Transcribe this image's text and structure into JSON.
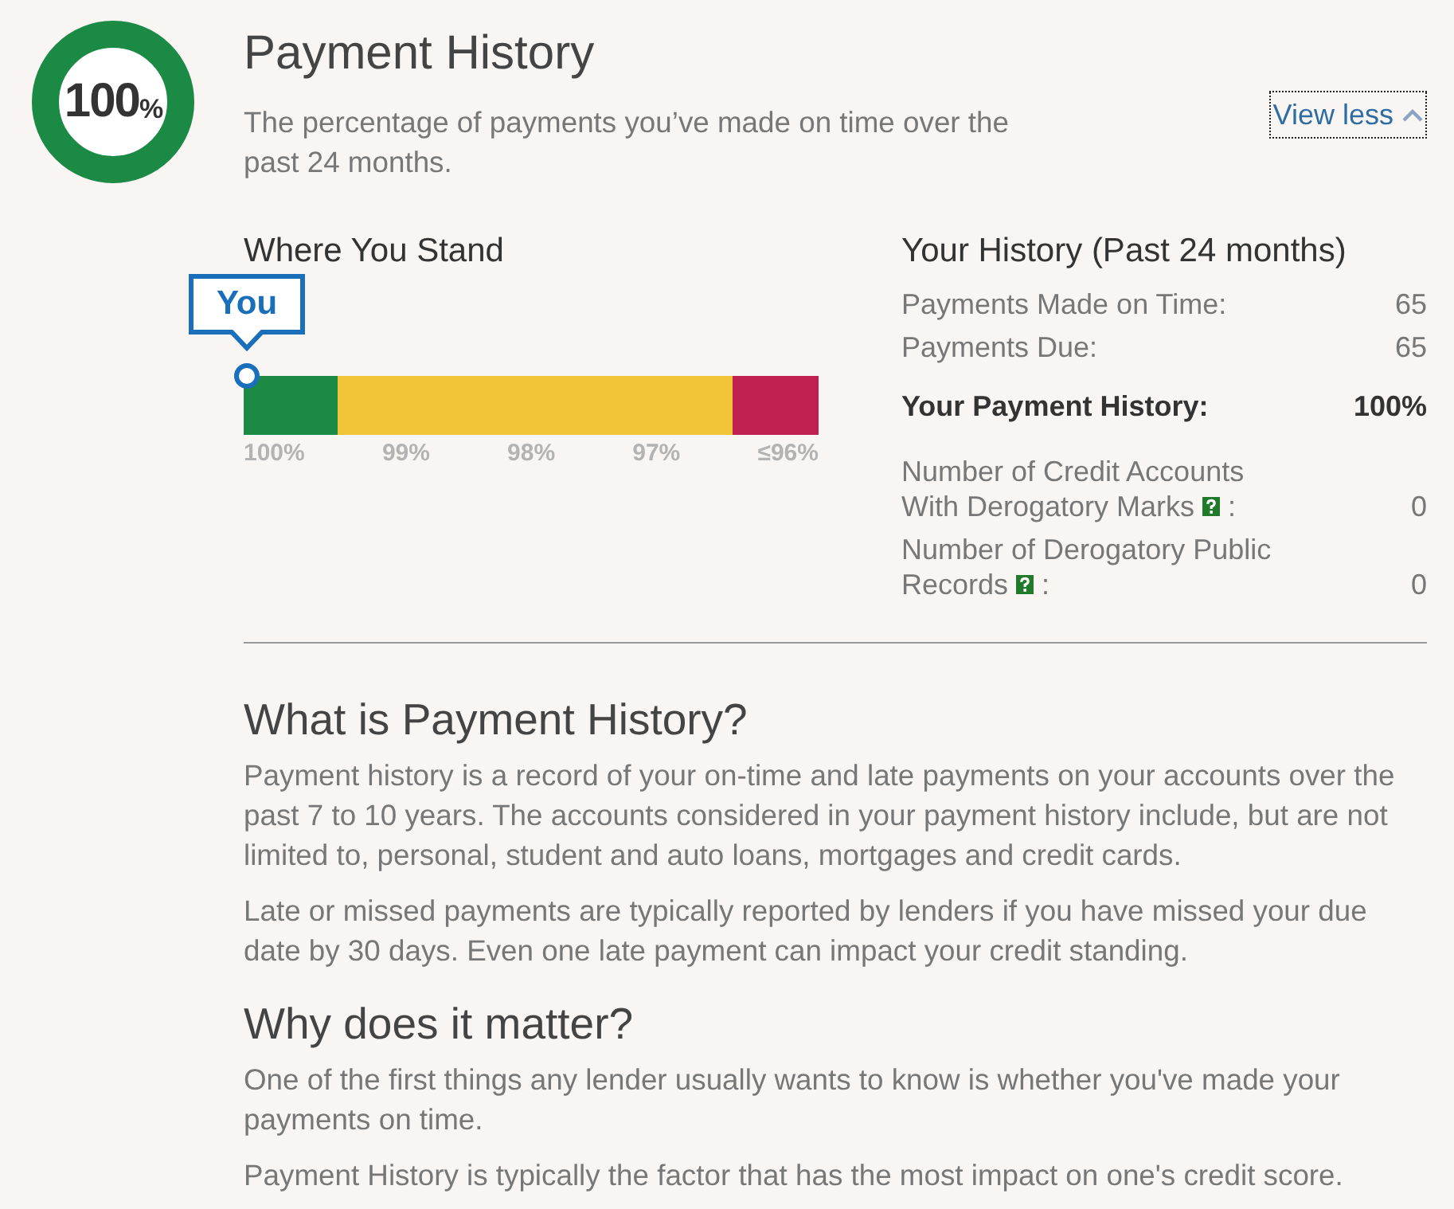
{
  "score_ring": {
    "value": "100",
    "unit": "%",
    "level": 1
  },
  "header": {
    "title": "Payment History",
    "description": "The percentage of payments you’ve made on time over the past 24 months.",
    "toggle": {
      "label": "View less",
      "expanded": true,
      "focused": true
    }
  },
  "where_you_stand": {
    "title": "Where You Stand",
    "marker": {
      "label": "You",
      "level": 0
    },
    "segments": [
      {
        "color": "#1b8a44"
      },
      {
        "color": "#f1c537"
      },
      {
        "color": "#c0204f"
      }
    ],
    "scale_labels": [
      "100%",
      "99%",
      "98%",
      "97%",
      "≤96%"
    ]
  },
  "your_history": {
    "title": "Your History (Past 24 months)",
    "rows": [
      {
        "kind": "plain",
        "label": "Payments Made on Time:",
        "value": "65"
      },
      {
        "kind": "plain",
        "label": "Payments Due:",
        "value": "65"
      },
      {
        "kind": "total",
        "label": "Your Payment History:",
        "value": "100%"
      },
      {
        "kind": "help",
        "label": "Number of Credit Accounts With Derogatory Marks",
        "suffix": ":",
        "value": "0"
      },
      {
        "kind": "help",
        "label": "Number of Derogatory Public Records",
        "suffix": ":",
        "value": "0"
      }
    ]
  },
  "sections": [
    {
      "title": "What is Payment History?",
      "paragraphs": [
        "Payment history is a record of your on-time and late payments on your accounts over the past 7 to 10 years. The accounts considered in your payment history include, but are not limited to, personal, student and auto loans, mortgages and credit cards.",
        "Late or missed payments are typically reported by lenders if you have missed your due date by 30 days. Even one late payment can impact your credit standing."
      ]
    },
    {
      "title": "Why does it matter?",
      "paragraphs": [
        "One of the first things any lender usually wants to know is whether you've made your payments on time.",
        "Payment History is typically the factor that has the most impact on one's credit score."
      ]
    }
  ]
}
